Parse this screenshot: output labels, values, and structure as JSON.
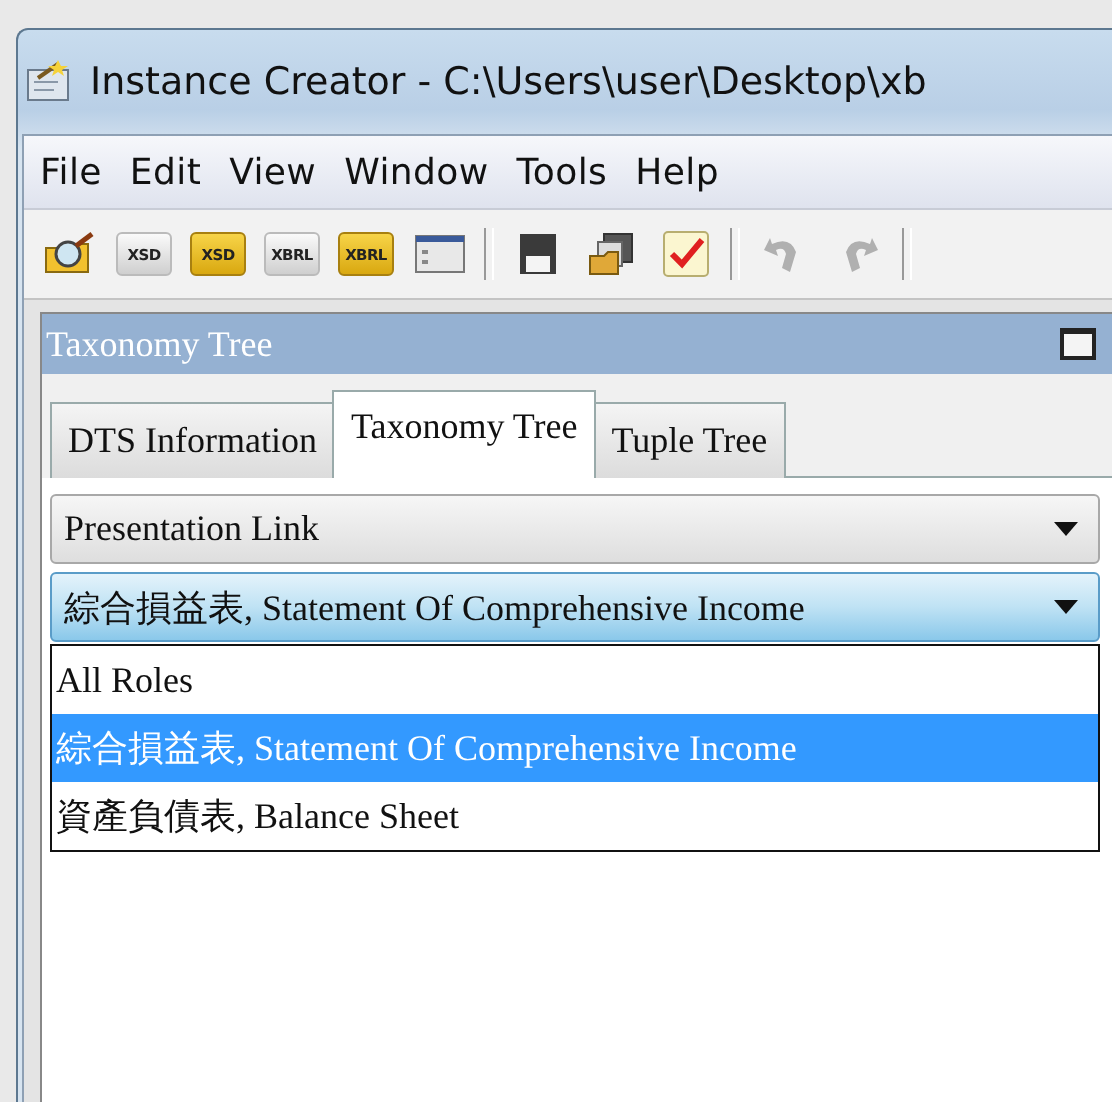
{
  "window": {
    "title": "Instance Creator - C:\\Users\\user\\Desktop\\xb"
  },
  "menu": [
    "File",
    "Edit",
    "View",
    "Window",
    "Tools",
    "Help"
  ],
  "toolbar": [
    {
      "kind": "open",
      "disabled": false
    },
    {
      "kind": "doc",
      "label": "XSD",
      "disabled": false
    },
    {
      "kind": "folder",
      "label": "XSD",
      "disabled": false
    },
    {
      "kind": "doc",
      "label": "XBRL",
      "disabled": false
    },
    {
      "kind": "folder",
      "label": "XBRL",
      "disabled": false
    },
    {
      "kind": "window",
      "disabled": false
    },
    {
      "kind": "separator"
    },
    {
      "kind": "save",
      "disabled": false
    },
    {
      "kind": "copy",
      "disabled": false
    },
    {
      "kind": "check",
      "disabled": false
    },
    {
      "kind": "separator"
    },
    {
      "kind": "undo",
      "disabled": true
    },
    {
      "kind": "redo",
      "disabled": true
    },
    {
      "kind": "separator"
    }
  ],
  "panel": {
    "title": "Taxonomy Tree"
  },
  "tabs": [
    {
      "label": "DTS Information",
      "selected": false
    },
    {
      "label": "Taxonomy Tree",
      "selected": true
    },
    {
      "label": "Tuple Tree",
      "selected": false
    }
  ],
  "link_dropdown": {
    "value": "Presentation Link",
    "focused": false
  },
  "role_dropdown": {
    "value": "綜合損益表, Statement Of Comprehensive Income",
    "focused": true
  },
  "role_options": [
    {
      "label": "All Roles",
      "selected": false
    },
    {
      "label": "綜合損益表, Statement Of Comprehensive Income",
      "selected": true
    },
    {
      "label": "資產負債表, Balance Sheet",
      "selected": false
    }
  ]
}
